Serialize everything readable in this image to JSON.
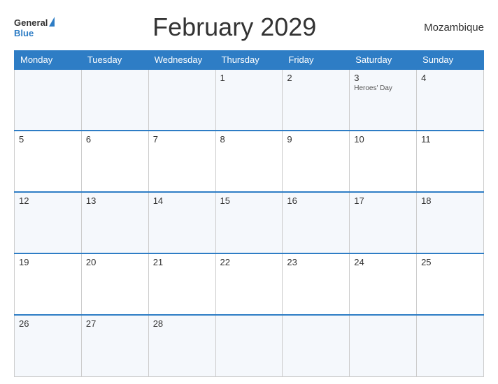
{
  "header": {
    "title": "February 2029",
    "country": "Mozambique",
    "logo_general": "General",
    "logo_blue": "Blue"
  },
  "days_of_week": [
    "Monday",
    "Tuesday",
    "Wednesday",
    "Thursday",
    "Friday",
    "Saturday",
    "Sunday"
  ],
  "weeks": [
    [
      {
        "num": "",
        "holiday": ""
      },
      {
        "num": "",
        "holiday": ""
      },
      {
        "num": "",
        "holiday": ""
      },
      {
        "num": "1",
        "holiday": ""
      },
      {
        "num": "2",
        "holiday": ""
      },
      {
        "num": "3",
        "holiday": "Heroes' Day"
      },
      {
        "num": "4",
        "holiday": ""
      }
    ],
    [
      {
        "num": "5",
        "holiday": ""
      },
      {
        "num": "6",
        "holiday": ""
      },
      {
        "num": "7",
        "holiday": ""
      },
      {
        "num": "8",
        "holiday": ""
      },
      {
        "num": "9",
        "holiday": ""
      },
      {
        "num": "10",
        "holiday": ""
      },
      {
        "num": "11",
        "holiday": ""
      }
    ],
    [
      {
        "num": "12",
        "holiday": ""
      },
      {
        "num": "13",
        "holiday": ""
      },
      {
        "num": "14",
        "holiday": ""
      },
      {
        "num": "15",
        "holiday": ""
      },
      {
        "num": "16",
        "holiday": ""
      },
      {
        "num": "17",
        "holiday": ""
      },
      {
        "num": "18",
        "holiday": ""
      }
    ],
    [
      {
        "num": "19",
        "holiday": ""
      },
      {
        "num": "20",
        "holiday": ""
      },
      {
        "num": "21",
        "holiday": ""
      },
      {
        "num": "22",
        "holiday": ""
      },
      {
        "num": "23",
        "holiday": ""
      },
      {
        "num": "24",
        "holiday": ""
      },
      {
        "num": "25",
        "holiday": ""
      }
    ],
    [
      {
        "num": "26",
        "holiday": ""
      },
      {
        "num": "27",
        "holiday": ""
      },
      {
        "num": "28",
        "holiday": ""
      },
      {
        "num": "",
        "holiday": ""
      },
      {
        "num": "",
        "holiday": ""
      },
      {
        "num": "",
        "holiday": ""
      },
      {
        "num": "",
        "holiday": ""
      }
    ]
  ]
}
